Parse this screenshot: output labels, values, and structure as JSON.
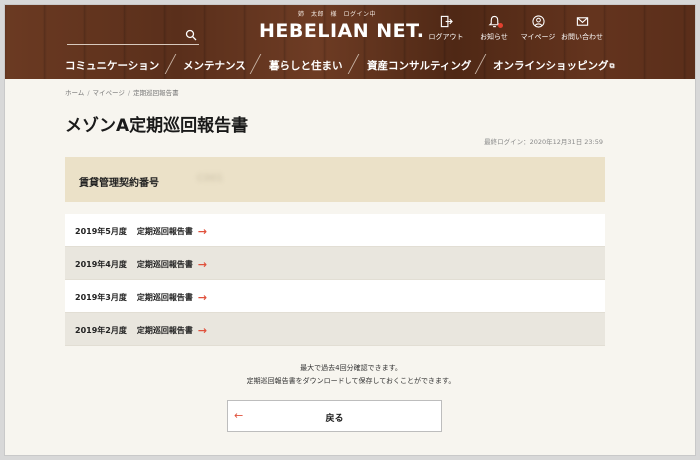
{
  "header": {
    "greeting": "姉　太郎　様　ログイン中",
    "logo": "HEBELIAN NET.",
    "icons": [
      {
        "icon": "logout-icon",
        "label": "ログアウト"
      },
      {
        "icon": "bell-icon",
        "label": "お知らせ"
      },
      {
        "icon": "user-icon",
        "label": "マイページ"
      },
      {
        "icon": "mail-icon",
        "label": "お問い合わせ"
      }
    ]
  },
  "nav": {
    "items": [
      {
        "label": "コミュニケーション"
      },
      {
        "label": "メンテナンス"
      },
      {
        "label": "暮らしと住まい"
      },
      {
        "label": "資産コンサルティング"
      },
      {
        "label": "オンラインショッピング"
      }
    ]
  },
  "breadcrumb": [
    "ホーム",
    "マイページ",
    "定期巡回報告書"
  ],
  "page": {
    "title": "メゾンA定期巡回報告書",
    "last_login": "最終ログイン：2020年12月31日 23:59"
  },
  "contract": {
    "label": "賃貸管理契約番号",
    "value": "C001"
  },
  "reports": [
    {
      "period": "2019年5月度",
      "name": "定期巡回報告書"
    },
    {
      "period": "2019年4月度",
      "name": "定期巡回報告書"
    },
    {
      "period": "2019年3月度",
      "name": "定期巡回報告書"
    },
    {
      "period": "2019年2月度",
      "name": "定期巡回報告書"
    }
  ],
  "notes": {
    "line1": "最大で過去4回分確認できます。",
    "line2": "定期巡回報告書をダウンロードして保存しておくことができます。"
  },
  "back_button": {
    "label": "戻る"
  },
  "colors": {
    "accent": "#e0513c",
    "contract_bg": "#ebe1c8",
    "row_alt": "#e9e6de"
  }
}
